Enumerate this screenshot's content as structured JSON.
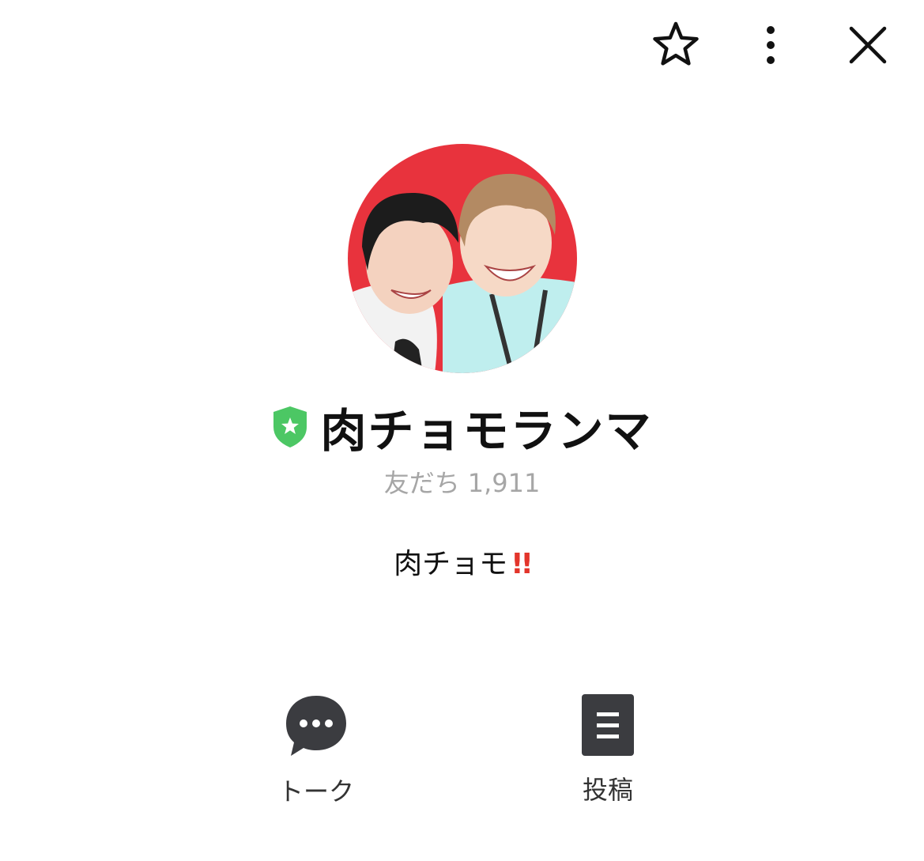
{
  "header": {
    "favorite_icon": "star-outline-icon",
    "more_icon": "vertical-ellipsis-icon",
    "close_icon": "close-x-icon"
  },
  "profile": {
    "badge_icon": "official-shield-star-icon",
    "badge_color": "#4cc764",
    "name": "肉チョモランマ",
    "friends_label": "友だち",
    "friends_count": "1,911",
    "status_text": "肉チョモ",
    "status_emoji": "!!",
    "avatar_background": "#e8333d"
  },
  "actions": [
    {
      "label": "トーク",
      "icon": "chat-bubble-icon"
    },
    {
      "label": "投稿",
      "icon": "post-document-icon"
    }
  ],
  "colors": {
    "icon_dark": "#3b3c40",
    "muted_text": "#a6a6a6"
  }
}
